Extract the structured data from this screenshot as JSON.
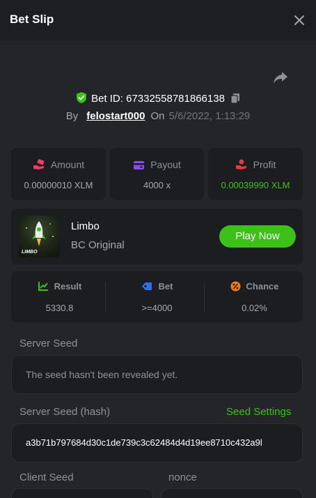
{
  "header": {
    "title": "Bet Slip"
  },
  "bet": {
    "id_text": "Bet ID: 67332558781866138",
    "by_label": "By",
    "user": "felostart000",
    "on_label": "On",
    "date": "5/6/2022, 1:13:29"
  },
  "stats": [
    {
      "label": "Amount",
      "value": "0.00000010 XLM",
      "icon": "money-hand-icon",
      "value_color": "#a4a8b0"
    },
    {
      "label": "Payout",
      "value": "4000 x",
      "icon": "wallet-icon",
      "value_color": "#a4a8b0"
    },
    {
      "label": "Profit",
      "value": "0.00039990 XLM",
      "icon": "profit-hand-icon",
      "value_color": "#3bc117"
    }
  ],
  "game": {
    "name": "Limbo",
    "provider": "BC Original",
    "play_label": "Play Now",
    "thumb_text": "LIMBO"
  },
  "result": [
    {
      "label": "Result",
      "value": "5330.8",
      "icon": "result-chart-icon"
    },
    {
      "label": "Bet",
      "value": ">=4000",
      "icon": "bet-tag-icon"
    },
    {
      "label": "Chance",
      "value": "0.02%",
      "icon": "percent-icon"
    }
  ],
  "seeds": {
    "server_seed_label": "Server Seed",
    "server_seed_value": "The seed hasn't been revealed yet.",
    "server_hash_label": "Server Seed (hash)",
    "seed_settings_label": "Seed Settings",
    "server_hash_value": "a3b71b797684d30c1de739c3c62484d4d19ee8710c432a9l",
    "client_seed_label": "Client Seed",
    "nonce_label": "nonce"
  },
  "colors": {
    "accent_green": "#3bc117",
    "background": "#232529",
    "card": "#1b1d21"
  }
}
